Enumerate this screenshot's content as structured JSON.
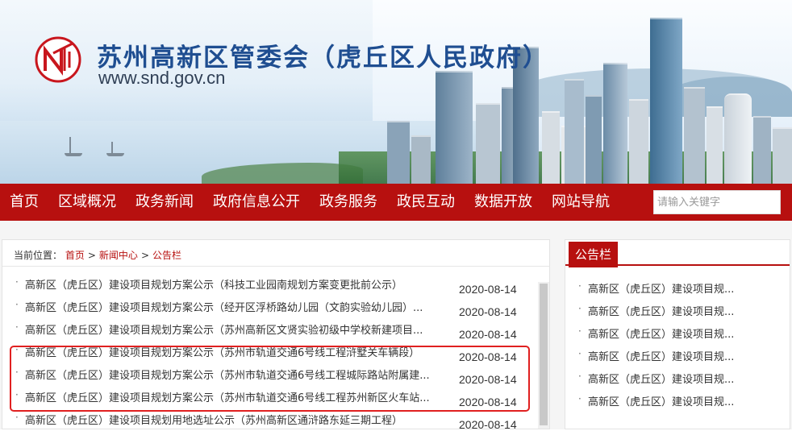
{
  "header": {
    "site_title": "苏州高新区管委会（虎丘区人民政府）",
    "site_url": "www.snd.gov.cn"
  },
  "nav": {
    "items": [
      "首页",
      "区域概况",
      "政务新闻",
      "政府信息公开",
      "政务服务",
      "政民互动",
      "数据开放",
      "网站导航"
    ],
    "search_placeholder": "请输入关键字"
  },
  "breadcrumb": {
    "prefix": "当前位置：",
    "items": [
      "首页",
      "新闻中心",
      "公告栏"
    ],
    "separator": ">"
  },
  "news": [
    {
      "title": "高新区（虎丘区）建设项目规划方案公示（科技工业园南规划方案变更批前公示）",
      "date": "2020-08-14"
    },
    {
      "title": "高新区（虎丘区）建设项目规划方案公示（经开区浮桥路幼儿园（文韵实验幼儿园）...",
      "date": "2020-08-14"
    },
    {
      "title": "高新区（虎丘区）建设项目规划方案公示（苏州高新区文贤实验初级中学校新建项目...",
      "date": "2020-08-14"
    },
    {
      "title": "高新区（虎丘区）建设项目规划方案公示（苏州市轨道交通6号线工程浒墅关车辆段）",
      "date": "2020-08-14"
    },
    {
      "title": "高新区（虎丘区）建设项目规划方案公示（苏州市轨道交通6号线工程城际路站附属建...",
      "date": "2020-08-14"
    },
    {
      "title": "高新区（虎丘区）建设项目规划方案公示（苏州市轨道交通6号线工程苏州新区火车站...",
      "date": "2020-08-14"
    },
    {
      "title": "高新区（虎丘区）建设项目规划用地选址公示（苏州高新区通浒路东延三期工程）",
      "date": "2020-08-14"
    }
  ],
  "sidebar": {
    "title": "公告栏",
    "items": [
      "高新区（虎丘区）建设项目规...",
      "高新区（虎丘区）建设项目规...",
      "高新区（虎丘区）建设项目规...",
      "高新区（虎丘区）建设项目规...",
      "高新区（虎丘区）建设项目规...",
      "高新区（虎丘区）建设项目规..."
    ]
  },
  "colors": {
    "brand_red": "#b7100f",
    "title_blue": "#1f4e91",
    "highlight_red": "#e02020"
  }
}
